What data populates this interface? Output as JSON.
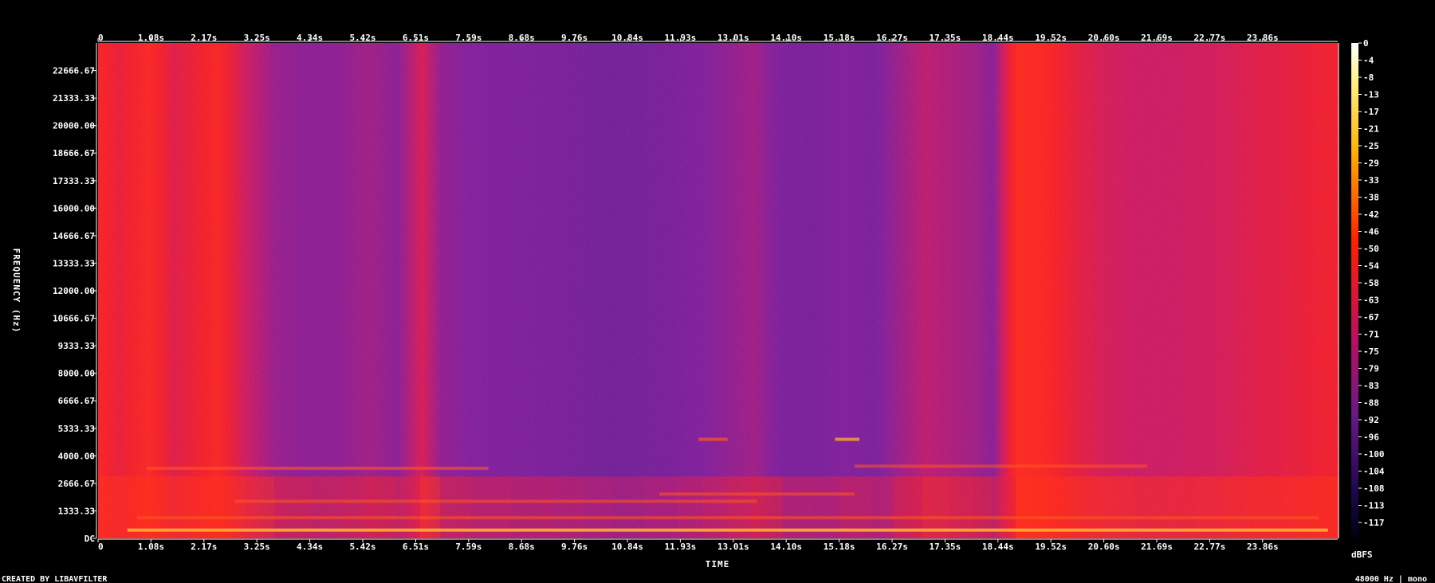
{
  "chart_data": {
    "type": "heatmap",
    "subtype": "spectrogram",
    "xlabel": "TIME",
    "ylabel": "FREQUENCY (Hz)",
    "colorbar_label": "dBFS",
    "footer_left": "CREATED BY LIBAVFILTER",
    "footer_right": "48000 Hz | mono",
    "x_ticks": [
      "0",
      "1.08s",
      "2.17s",
      "3.25s",
      "4.34s",
      "5.42s",
      "6.51s",
      "7.59s",
      "8.68s",
      "9.76s",
      "10.84s",
      "11.93s",
      "13.01s",
      "14.10s",
      "15.18s",
      "16.27s",
      "17.35s",
      "18.44s",
      "19.52s",
      "20.60s",
      "21.69s",
      "22.77s",
      "23.86s"
    ],
    "y_ticks": [
      "DC",
      "1333.33",
      "2666.67",
      "4000.00",
      "5333.33",
      "6666.67",
      "8000.00",
      "9333.33",
      "10666.67",
      "12000.00",
      "13333.33",
      "14666.67",
      "16000.00",
      "17333.33",
      "18666.67",
      "20000.00",
      "21333.33",
      "22666.67"
    ],
    "colorbar_ticks": [
      "0",
      "-4",
      "-8",
      "-13",
      "-17",
      "-21",
      "-25",
      "-29",
      "-33",
      "-38",
      "-42",
      "-46",
      "-50",
      "-54",
      "-58",
      "-63",
      "-67",
      "-71",
      "-75",
      "-79",
      "-83",
      "-88",
      "-92",
      "-96",
      "-100",
      "-104",
      "-108",
      "-113",
      "-117"
    ],
    "x_range_s": [
      0,
      25.4
    ],
    "y_range_hz": [
      0,
      24000
    ],
    "db_range": [
      -120,
      0
    ],
    "colors": {
      "high": "#ffffff",
      "mid_high": "#ffd020",
      "mid": "#ff2000",
      "mid_low": "#7a1a8f",
      "low": "#1a0040",
      "floor": "#000010"
    },
    "energy_profile": {
      "time_s": [
        0.0,
        0.4,
        1.0,
        1.5,
        2.0,
        2.4,
        3.0,
        3.6,
        4.3,
        5.0,
        5.5,
        6.1,
        6.6,
        7.0,
        7.6,
        8.4,
        9.2,
        9.9,
        10.5,
        11.2,
        11.9,
        12.4,
        12.9,
        13.4,
        14.0,
        14.6,
        15.2,
        15.8,
        16.3,
        16.9,
        17.4,
        17.9,
        18.3,
        18.8,
        19.3,
        19.9,
        20.5,
        21.2,
        21.8,
        22.5,
        23.1,
        23.7,
        24.2,
        24.6,
        25.0,
        25.4
      ],
      "level": [
        0.85,
        0.75,
        0.9,
        0.7,
        0.78,
        0.88,
        0.6,
        0.42,
        0.38,
        0.4,
        0.45,
        0.38,
        0.65,
        0.4,
        0.35,
        0.32,
        0.3,
        0.25,
        0.22,
        0.25,
        0.3,
        0.35,
        0.4,
        0.45,
        0.3,
        0.28,
        0.35,
        0.3,
        0.42,
        0.55,
        0.5,
        0.45,
        0.38,
        0.95,
        0.9,
        0.75,
        0.65,
        0.6,
        0.6,
        0.62,
        0.65,
        0.7,
        0.72,
        0.75,
        0.78,
        0.8
      ]
    },
    "harmonic_bands": [
      {
        "freq_hz": 400,
        "start_s": 0.6,
        "end_s": 25.2,
        "strength": 0.9
      },
      {
        "freq_hz": 1000,
        "start_s": 0.8,
        "end_s": 25.0,
        "strength": 0.55
      },
      {
        "freq_hz": 1800,
        "start_s": 2.8,
        "end_s": 13.5,
        "strength": 0.55
      },
      {
        "freq_hz": 2150,
        "start_s": 11.5,
        "end_s": 15.5,
        "strength": 0.55
      },
      {
        "freq_hz": 3400,
        "start_s": 1.0,
        "end_s": 8.0,
        "strength": 0.6
      },
      {
        "freq_hz": 3500,
        "start_s": 15.5,
        "end_s": 21.5,
        "strength": 0.55
      },
      {
        "freq_hz": 4800,
        "start_s": 12.3,
        "end_s": 12.9,
        "strength": 0.7
      },
      {
        "freq_hz": 4800,
        "start_s": 15.1,
        "end_s": 15.6,
        "strength": 0.75
      }
    ]
  }
}
